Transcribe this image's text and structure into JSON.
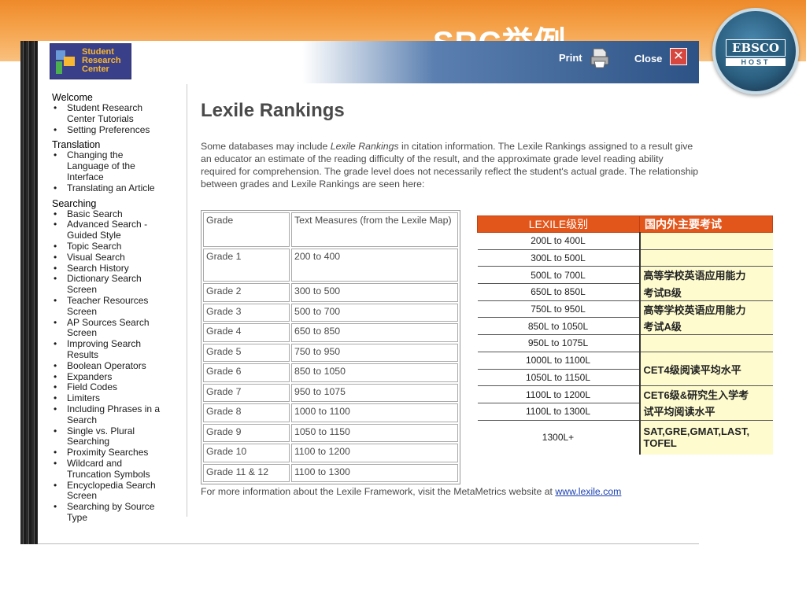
{
  "slide": {
    "title": "SRC举例"
  },
  "ebsco": {
    "name": "EBSCO",
    "host": "HOST"
  },
  "window": {
    "logo": {
      "line1": "Student",
      "line2": "Research",
      "line3": "Center"
    },
    "print_label": "Print",
    "close_label": "Close",
    "close_glyph": "✕"
  },
  "sidebar": {
    "sections": [
      {
        "heading": "Welcome",
        "items": [
          "Student Research Center Tutorials",
          "Setting Preferences"
        ]
      },
      {
        "heading": "Translation",
        "items": [
          "Changing the Language of the Interface",
          "Translating an Article"
        ]
      },
      {
        "heading": "Searching",
        "items": [
          "Basic Search",
          "Advanced Search - Guided Style",
          "Topic Search",
          "Visual Search",
          "Search History",
          "Dictionary Search Screen",
          "Teacher Resources Screen",
          "AP Sources Search Screen",
          "Improving Search Results",
          "Boolean Operators",
          "Expanders",
          "Field Codes",
          "Limiters",
          "Including Phrases in a Search",
          "Single vs. Plural Searching",
          "Proximity Searches",
          "Wildcard and Truncation Symbols",
          "Encyclopedia Search Screen",
          "Searching by Source Type"
        ]
      }
    ]
  },
  "main": {
    "title": "Lexile Rankings",
    "intro_1": "Some databases may include ",
    "intro_em": "Lexile Rankings",
    "intro_2": " in citation information. The Lexile Rankings assigned to a result give an educator an estimate of the reading difficulty of the result, and the approximate grade level reading ability required for comprehension. The grade level does not necessarily reflect the student's actual grade. The relationship between grades and Lexile Rankings are seen here:",
    "grade_table": {
      "header": [
        "Grade",
        "Text Measures (from the Lexile Map)"
      ],
      "rows": [
        [
          "Grade 1",
          "200 to 400"
        ],
        [
          "Grade 2",
          "300 to 500"
        ],
        [
          "Grade 3",
          "500 to 700"
        ],
        [
          "Grade 4",
          "650 to 850"
        ],
        [
          "Grade 5",
          "750 to 950"
        ],
        [
          "Grade 6",
          "850 to 1050"
        ],
        [
          "Grade 7",
          "950 to 1075"
        ],
        [
          "Grade 8",
          "1000 to 1100"
        ],
        [
          "Grade 9",
          "1050 to 1150"
        ],
        [
          "Grade 10",
          "1100 to 1200"
        ],
        [
          "Grade 11 & 12",
          "1100 to 1300"
        ]
      ]
    },
    "footer_text": "For more information about the Lexile Framework, visit the MetaMetrics website at ",
    "footer_link": "www.lexile.com"
  },
  "lexile_table": {
    "header": [
      "LEXILE级别",
      "国内外主要考试"
    ],
    "levels": [
      "200L to 400L",
      "300L to 500L",
      "500L to 700L",
      "650L to 850L",
      "750L to 950L",
      "850L to 1050L",
      "950L to 1075L",
      "1000L to 1100L",
      "1050L to 1150L",
      "1100L to 1200L",
      "1100L to 1300L",
      "1300L+"
    ],
    "exams": {
      "e1": "高等学校英语应用能力",
      "e1b": "考试B级",
      "e2": "高等学校英语应用能力",
      "e2b": "考试A级",
      "e3": "CET4级阅读平均水平",
      "e4": "CET6级&研究生入学考",
      "e4b": "试平均阅读水平",
      "e5": "SAT,GRE,GMAT,LAST,",
      "e5b": "TOFEL"
    }
  }
}
